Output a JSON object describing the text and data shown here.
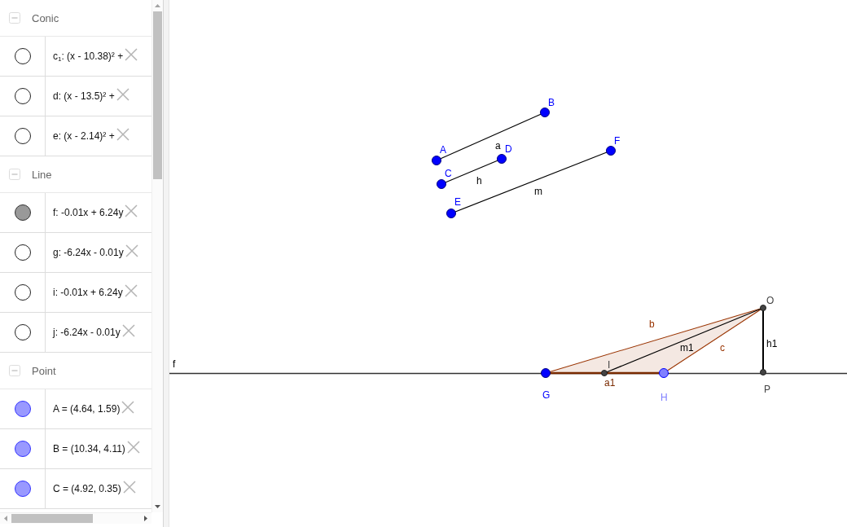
{
  "algebra_view": {
    "groups": [
      {
        "label": "Conic",
        "expanded": true,
        "items": [
          {
            "text": "c$_{1}$: (x - 10.38)² +",
            "visible": false
          },
          {
            "text": "d: (x - 13.5)² +",
            "visible": false
          },
          {
            "text": "e: (x - 2.14)² +",
            "visible": false
          }
        ]
      },
      {
        "label": "Line",
        "expanded": true,
        "items": [
          {
            "text": "f: -0.01x + 6.24y",
            "visible": true,
            "color": "#999999"
          },
          {
            "text": "g: -6.24x - 0.01y",
            "visible": false
          },
          {
            "text": "i: -0.01x + 6.24y",
            "visible": false
          },
          {
            "text": "j: -6.24x - 0.01y",
            "visible": false
          }
        ]
      },
      {
        "label": "Point",
        "expanded": true,
        "items": [
          {
            "text": "A = (4.64, 1.59)",
            "visible": true,
            "color": "#9999ff"
          },
          {
            "text": "B = (10.34, 4.11)",
            "visible": true,
            "color": "#9999ff"
          },
          {
            "text": "C = (4.92, 0.35)",
            "visible": true,
            "color": "#9999ff"
          }
        ]
      }
    ]
  },
  "graphics_view": {
    "points": [
      {
        "label": "A",
        "kind": "free",
        "color": "#0000ff"
      },
      {
        "label": "B",
        "kind": "free",
        "color": "#0000ff"
      },
      {
        "label": "C",
        "kind": "free",
        "color": "#0000ff"
      },
      {
        "label": "D",
        "kind": "free",
        "color": "#0000ff"
      },
      {
        "label": "E",
        "kind": "free",
        "color": "#0000ff"
      },
      {
        "label": "F",
        "kind": "free",
        "color": "#0000ff"
      },
      {
        "label": "G",
        "kind": "free",
        "color": "#0000ff"
      },
      {
        "label": "H",
        "kind": "free",
        "color": "#8080ff"
      },
      {
        "label": "I",
        "kind": "dependent",
        "color": "#444444"
      },
      {
        "label": "O",
        "kind": "dependent",
        "color": "#444444"
      },
      {
        "label": "P",
        "kind": "dependent",
        "color": "#444444"
      }
    ],
    "lines": [
      {
        "label": "f"
      }
    ],
    "segments": [
      {
        "label": "a",
        "color": "#000000"
      },
      {
        "label": "h",
        "color": "#000000"
      },
      {
        "label": "m",
        "color": "#000000"
      },
      {
        "label": "b",
        "color": "#993300"
      },
      {
        "label": "c",
        "color": "#993300"
      },
      {
        "label": "a1",
        "color": "#7a2a00"
      },
      {
        "label": "m1",
        "color": "#000000"
      },
      {
        "label": "h1",
        "color": "#000000"
      }
    ],
    "polygon": {
      "shaded": true
    }
  }
}
